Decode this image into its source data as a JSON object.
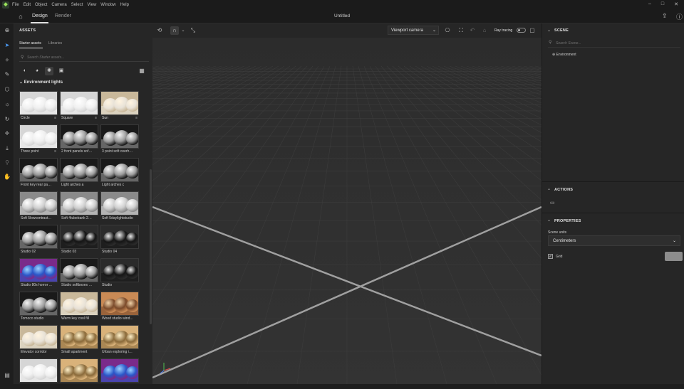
{
  "menu": [
    "File",
    "Edit",
    "Object",
    "Camera",
    "Select",
    "View",
    "Window",
    "Help"
  ],
  "window_controls": [
    "–",
    "□",
    "✕"
  ],
  "topbar": {
    "design_tab": "Design",
    "render_tab": "Render",
    "doc_title": "Untitled"
  },
  "assets_panel": {
    "title": "ASSETS",
    "tabs": [
      "Starter assets",
      "Libraries"
    ],
    "search_placeholder": "Search Starter assets...",
    "section": "Environment lights",
    "tiles": [
      {
        "label": "Circle",
        "style": "white",
        "adj": "≡"
      },
      {
        "label": "Square",
        "style": "white",
        "adj": "≡"
      },
      {
        "label": "Sun",
        "style": "warm",
        "adj": "≡"
      },
      {
        "label": "Three point",
        "style": "white",
        "adj": "≡"
      },
      {
        "label": "2 front panels soft ...",
        "style": "chrome"
      },
      {
        "label": "3 point soft overhe...",
        "style": "chrome"
      },
      {
        "label": "Front key rear pan...",
        "style": "chrome"
      },
      {
        "label": "Light arches a",
        "style": "chrome"
      },
      {
        "label": "Light arches c",
        "style": "chrome"
      },
      {
        "label": "Soft 5lowcontrastfr...",
        "style": "grey"
      },
      {
        "label": "Soft 4tubebank 2b...",
        "style": "grey"
      },
      {
        "label": "Soft 5daylightstudio",
        "style": "grey"
      },
      {
        "label": "Studio 02",
        "style": "chrome"
      },
      {
        "label": "Studio 03",
        "style": "dark"
      },
      {
        "label": "Studio 04",
        "style": "dark"
      },
      {
        "label": "Studio 80s horror ...",
        "style": "blue"
      },
      {
        "label": "Studio softboxes 3...",
        "style": "chrome"
      },
      {
        "label": "Studio",
        "style": "dark"
      },
      {
        "label": "Tomoco studio",
        "style": "chrome"
      },
      {
        "label": "Warm key cool fill",
        "style": "warm"
      },
      {
        "label": "Wood studio wind...",
        "style": "wood"
      },
      {
        "label": "Elevator corridor",
        "style": "warm"
      },
      {
        "label": "Small apartment",
        "style": "gold"
      },
      {
        "label": "Urban exploring in...",
        "style": "gold"
      },
      {
        "label": "",
        "style": "white"
      },
      {
        "label": "",
        "style": "gold"
      },
      {
        "label": "",
        "style": "blue"
      }
    ]
  },
  "viewport": {
    "camera_label": "Viewport camera",
    "ray_tracing_label": "Ray tracing"
  },
  "right_panel": {
    "scene_title": "SCENE",
    "scene_search_placeholder": "Search Scene...",
    "environment_label": "Environment",
    "actions_title": "ACTIONS",
    "properties_title": "PROPERTIES",
    "scene_units_label": "Scene units",
    "scene_units_value": "Centimeters",
    "grid_label": "Grid"
  },
  "colors": {
    "accent": "#4ea0ff",
    "grid_color_swatch": "#8c8c8c"
  }
}
